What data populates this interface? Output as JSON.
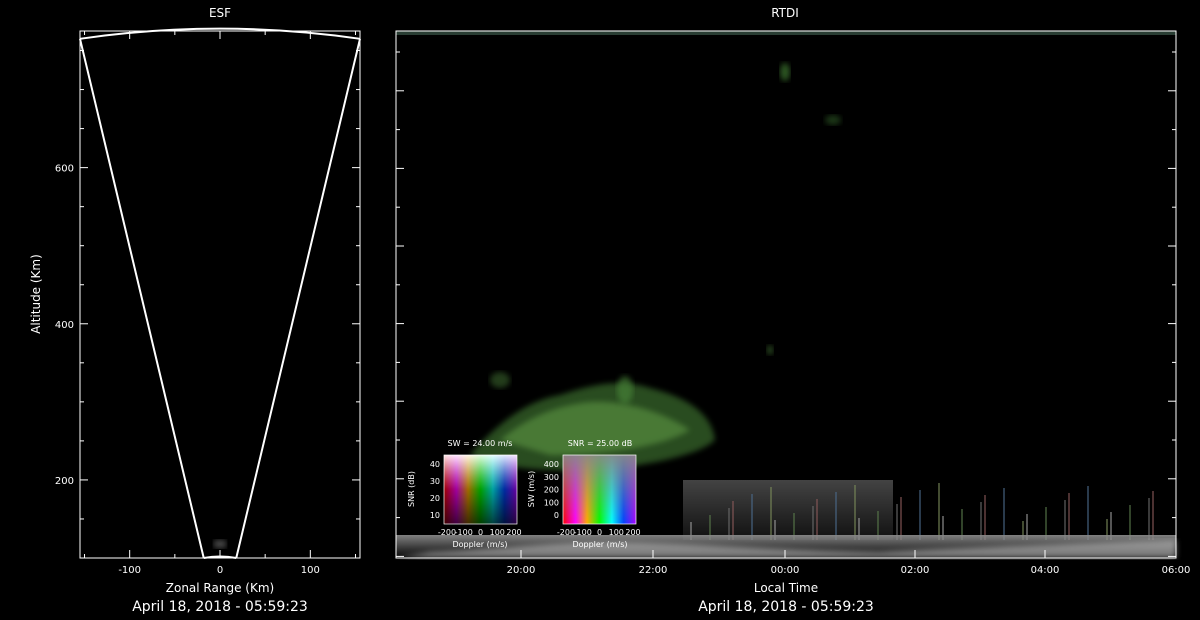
{
  "chart_data": [
    {
      "type": "other",
      "title": "ESF",
      "xlabel": "Zonal Range (Km)",
      "ylabel": "Altitude (Km)",
      "xlim": [
        -155,
        155
      ],
      "ylim": [
        100,
        775
      ],
      "xticks": [
        -100,
        0,
        100
      ],
      "yticks": [
        200,
        400,
        600
      ],
      "timestamp": "April 18, 2018 - 05:59:23",
      "fan": {
        "apex_halfwidth": 18,
        "top_halfwidth": 155,
        "top_altitude": 765,
        "arc_peak_altitude": 778
      }
    },
    {
      "type": "heatmap",
      "title": "RTDI",
      "xlabel": "Local Time",
      "timestamp": "April 18, 2018 - 05:59:23",
      "xticks": [
        "20:00",
        "22:00",
        "00:00",
        "02:00",
        "04:00",
        "06:00"
      ],
      "legends": [
        {
          "title": "SW = 24.00 m/s",
          "xlabel": "Doppler (m/s)",
          "ylabel": "SNR (dB)",
          "xticks": [
            "-200",
            "-100",
            "0",
            "100",
            "200"
          ],
          "yticks": [
            "10",
            "20",
            "30",
            "40"
          ]
        },
        {
          "title": "SNR = 25.00 dB",
          "xlabel": "Doppler (m/s)",
          "ylabel": "SW (m/s)",
          "xticks": [
            "-200",
            "-100",
            "0",
            "100",
            "200"
          ],
          "yticks": [
            "0",
            "100",
            "200",
            "300",
            "400"
          ]
        }
      ]
    }
  ],
  "colors": {
    "background": "#000000",
    "axis": "#ffffff",
    "echo_green": "#4c8a3a"
  }
}
